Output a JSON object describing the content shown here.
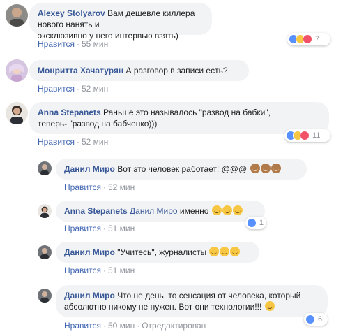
{
  "comments": [
    {
      "author": "Alexey Stolyarov",
      "text_line1": "Вам дешевле киллера нового нанять и",
      "text_line2": "эксклюзивно у него интервью взять)",
      "like_label": "Нравится",
      "time": "55 мин",
      "reaction_count": "7"
    },
    {
      "author": "Монритта Хачатурян",
      "text_line1": "А разговор в записи есть?",
      "like_label": "Нравится",
      "time": "52 мин"
    },
    {
      "author": "Anna Stepanets",
      "text_line1": "Раньше это называлось \"развод на бабки\",",
      "text_line2": "теперь- \"развод на бабченко)))",
      "like_label": "Нравится",
      "time": "52 мин",
      "reaction_count": "11"
    }
  ],
  "replies": [
    {
      "author": "Данил Миро",
      "text": "Вот это человек работает! @@@",
      "like_label": "Нравится",
      "time": "52 мин"
    },
    {
      "author": "Anna Stepanets",
      "mention": "Данил Миро",
      "text": "именно",
      "like_label": "Нравится",
      "time": "51 мин",
      "reaction_count": "1"
    },
    {
      "author": "Данил Миро",
      "text": "\"Учитесь\", журналисты",
      "like_label": "Нравится",
      "time": "51 мин"
    },
    {
      "author": "Данил Миро",
      "text_line1": "Что не день, то сенсация от человека, который",
      "text_line2": "абсолютно никому не нужен. Вот они технологии!!!",
      "like_label": "Нравится",
      "time": "50 мин",
      "edited_label": "Отредактирован",
      "reaction_count": "6"
    }
  ],
  "separator": "·",
  "colors": {
    "author": "#385898",
    "bubble": "#f2f3f5",
    "meta": "#90949c",
    "like_action": "#4267b2"
  }
}
